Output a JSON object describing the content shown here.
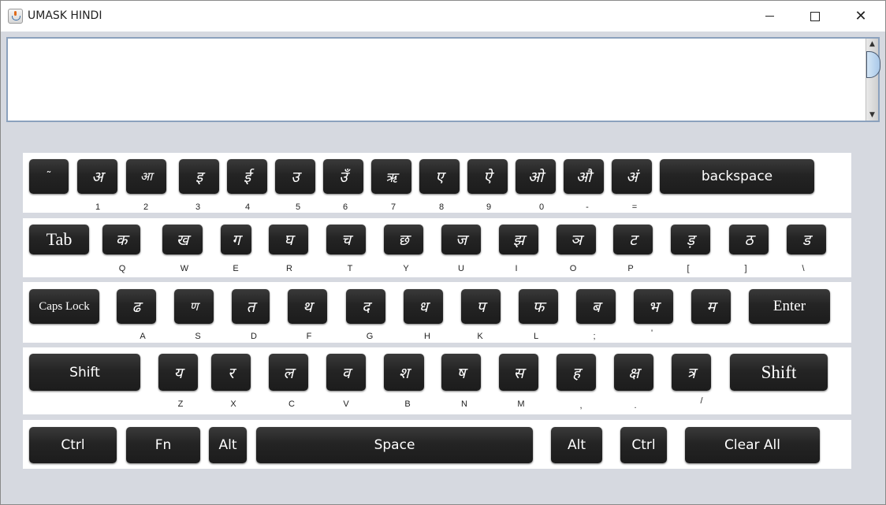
{
  "window": {
    "title": "UMASK HINDI",
    "controls": {
      "minimize": "—",
      "maximize": "☐",
      "close": "✕"
    }
  },
  "text_area": {
    "value": "",
    "scroll_up": "▲",
    "scroll_down": "▼"
  },
  "keyboard": {
    "row1": {
      "keys": [
        "˜",
        "अ",
        "आ",
        "इ",
        "ई",
        "उ",
        "उँ",
        "ऋ",
        "ए",
        "ऐ",
        "ओ",
        "औ",
        "अं",
        "backspace"
      ],
      "sublabels": [
        "",
        "1",
        "2",
        "3",
        "4",
        "5",
        "6",
        "7",
        "8",
        "9",
        "0",
        "-",
        "=",
        ""
      ]
    },
    "row2": {
      "keys": [
        "Tab",
        "क",
        "ख",
        "ग",
        "घ",
        "च",
        "छ",
        "ज",
        "झ",
        "ञ",
        "ट",
        "ड़",
        "ठ",
        "ड"
      ],
      "sublabels": [
        "",
        "Q",
        "W",
        "E",
        "R",
        "T",
        "Y",
        "U",
        "I",
        "O",
        "P",
        "[",
        "]",
        "\\"
      ]
    },
    "row3": {
      "keys": [
        "Caps Lock",
        "ढ",
        "ण",
        "त",
        "थ",
        "द",
        "ध",
        "प",
        "फ",
        "ब",
        "भ",
        "म",
        "Enter"
      ],
      "sublabels": [
        "",
        "A",
        "S",
        "D",
        "F",
        "G",
        "H",
        "K",
        "L",
        ";",
        "'",
        "",
        ""
      ]
    },
    "row4": {
      "keys": [
        "Shift",
        "य",
        "र",
        "ल",
        "व",
        "श",
        "ष",
        "स",
        "ह",
        "क्ष",
        "त्र",
        "Shift"
      ],
      "sublabels": [
        "",
        "Z",
        "X",
        "C",
        "V",
        "B",
        "N",
        "M",
        ",",
        ".",
        "/",
        ""
      ]
    },
    "row5": {
      "keys": [
        "Ctrl",
        "Fn",
        "Alt",
        "Space",
        "Alt",
        "Ctrl",
        "Clear All"
      ]
    }
  }
}
